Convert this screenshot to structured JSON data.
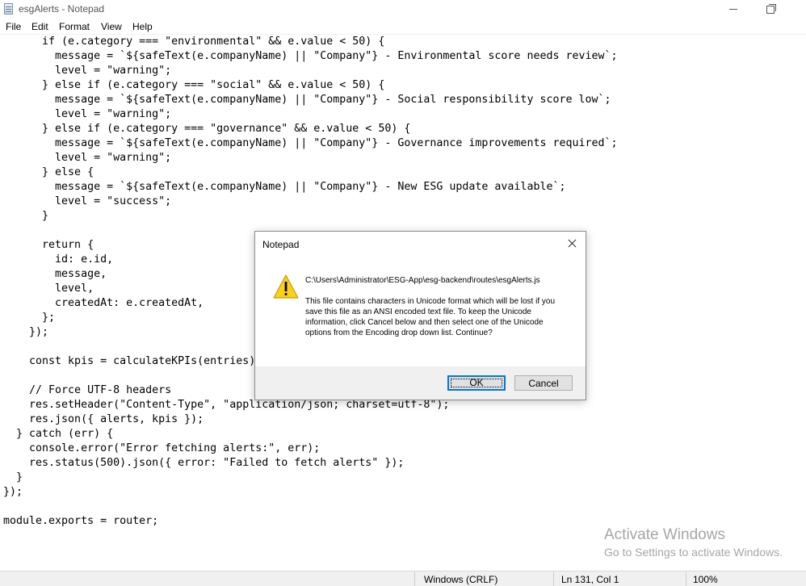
{
  "window": {
    "title": "esgAlerts - Notepad",
    "icon": "notepad-icon"
  },
  "menu": [
    "File",
    "Edit",
    "Format",
    "View",
    "Help"
  ],
  "editor": {
    "lines": [
      "      if (e.category === \"environmental\" && e.value < 50) {",
      "        message = `${safeText(e.companyName) || \"Company\"} - Environmental score needs review`;",
      "        level = \"warning\";",
      "      } else if (e.category === \"social\" && e.value < 50) {",
      "        message = `${safeText(e.companyName) || \"Company\"} - Social responsibility score low`;",
      "        level = \"warning\";",
      "      } else if (e.category === \"governance\" && e.value < 50) {",
      "        message = `${safeText(e.companyName) || \"Company\"} - Governance improvements required`;",
      "        level = \"warning\";",
      "      } else {",
      "        message = `${safeText(e.companyName) || \"Company\"} - New ESG update available`;",
      "        level = \"success\";",
      "      }",
      "",
      "      return {",
      "        id: e.id,",
      "        message,",
      "        level,",
      "        createdAt: e.createdAt,",
      "      };",
      "    });",
      "",
      "    const kpis = calculateKPIs(entries);",
      "",
      "    // Force UTF-8 headers",
      "    res.setHeader(\"Content-Type\", \"application/json; charset=utf-8\");",
      "    res.json({ alerts, kpis });",
      "  } catch (err) {",
      "    console.error(\"Error fetching alerts:\", err);",
      "    res.status(500).json({ error: \"Failed to fetch alerts\" });",
      "  }",
      "});",
      "",
      "module.exports = router;"
    ]
  },
  "status": {
    "encoding": "Windows (CRLF)",
    "position": "Ln 131, Col 1",
    "zoom": "100%"
  },
  "watermark": {
    "title": "Activate Windows",
    "subtitle": "Go to Settings to activate Windows."
  },
  "dialog": {
    "title": "Notepad",
    "path": "C:\\Users\\Administrator\\ESG-App\\esg-backend\\routes\\esgAlerts.js",
    "message": "This file contains characters in Unicode format which will be lost if you save this file as an ANSI encoded text file. To keep the Unicode information, click Cancel below and then select one of the Unicode options from the Encoding drop down list. Continue?",
    "ok_label": "OK",
    "cancel_label": "Cancel",
    "icon": "warning-icon"
  }
}
